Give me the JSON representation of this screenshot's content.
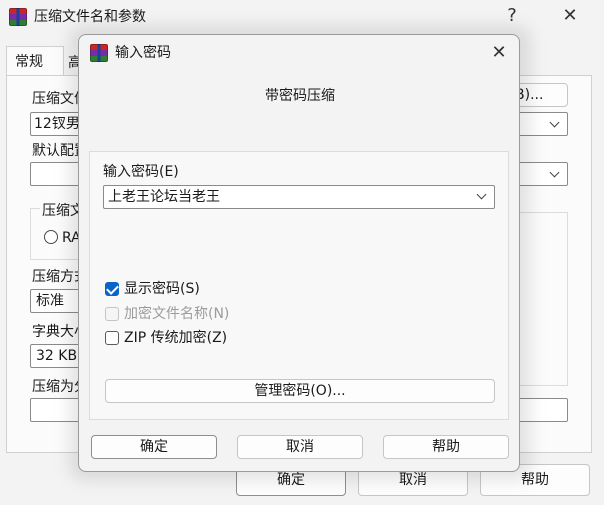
{
  "main_window": {
    "title": "压缩文件名和参数",
    "help_glyph": "?",
    "close_glyph": "✕",
    "tabs": [
      {
        "label": "常规",
        "active": true
      },
      {
        "label": "高",
        "active": false
      }
    ],
    "archive_name_label": "压缩文件",
    "archive_name_value": "12钗男",
    "browse_button_tail": "B)...",
    "default_profile_label": "默认配置",
    "archive_format_group": "压缩文",
    "archive_format_radio": "RA",
    "compression_method_label": "压缩方式",
    "compression_method_value": "标准",
    "dictionary_size_label": "字典大小",
    "dictionary_size_value": "32 KB",
    "split_volume_label": "压缩为分",
    "buttons": {
      "ok": "确定",
      "cancel": "取消",
      "help": "帮助"
    }
  },
  "dialog": {
    "title": "输入密码",
    "close_glyph": "✕",
    "heading": "带密码压缩",
    "password_label": "输入密码(E)",
    "password_value": "上老王论坛当老王",
    "show_password": {
      "label": "显示密码(S)",
      "checked": true,
      "enabled": true
    },
    "encrypt_filenames": {
      "label": "加密文件名称(N)",
      "checked": false,
      "enabled": false
    },
    "zip_legacy": {
      "label": "ZIP 传统加密(Z)",
      "checked": false,
      "enabled": true
    },
    "manage_button": "管理密码(O)...",
    "buttons": {
      "ok": "确定",
      "cancel": "取消",
      "help": "帮助"
    }
  },
  "colors": {
    "window_bg": "#f3f3f3",
    "accent": "#0a64c8",
    "disabled_text": "#9c9c9c"
  },
  "icons": {
    "app_icon": "winrar-books-icon",
    "dropdown": "chevron-down-icon"
  }
}
